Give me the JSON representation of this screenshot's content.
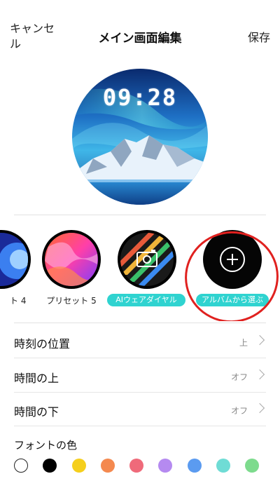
{
  "header": {
    "cancel_label": "キャンセル",
    "title": "メイン画面編集",
    "save_label": "保存"
  },
  "preview": {
    "time": "09:28"
  },
  "presets": [
    {
      "label": "ト 4"
    },
    {
      "label": "プリセット 5"
    },
    {
      "label": "AIウェアダイヤル"
    },
    {
      "label": "アルバムから選ぶ"
    }
  ],
  "settings": [
    {
      "label": "時刻の位置",
      "value": "上"
    },
    {
      "label": "時間の上",
      "value": "オフ"
    },
    {
      "label": "時間の下",
      "value": "オフ"
    }
  ],
  "font_color": {
    "label": "フォントの色",
    "swatches": [
      "#ffffff",
      "#000000",
      "#f5cf1c",
      "#f4894f",
      "#ef6a7a",
      "#b58af0",
      "#5b9bf0",
      "#6fdcd5",
      "#7ddb8d"
    ],
    "selected_index": 0
  },
  "colors": {
    "accent": "#2fd3d0",
    "highlight_circle": "#e0211f"
  }
}
